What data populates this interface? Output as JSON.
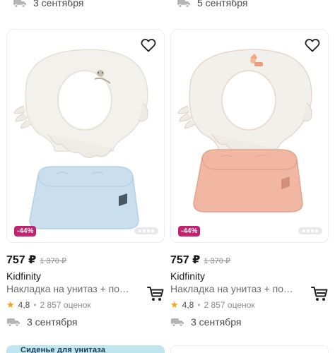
{
  "top": {
    "left_delivery": "3 сентября",
    "right_delivery": "5 сентября"
  },
  "products": [
    {
      "discount": "-44%",
      "price": "757 ₽",
      "old_price": "1 370 ₽",
      "brand": "Kidfinity",
      "title": "Накладка на унитаз + подставка",
      "rating": "4,8",
      "reviews": "2 857 оценок",
      "delivery": "3 сентября",
      "stool_color": "#c9dff0",
      "seat_accent": "sloth-motif"
    },
    {
      "discount": "-44%",
      "price": "757 ₽",
      "old_price": "1 370 ₽",
      "brand": "Kidfinity",
      "title": "Накладка на унитаз + подставка",
      "rating": "4,8",
      "reviews": "2 857 оценок",
      "delivery": "3 сентября",
      "stool_color": "#f1b7a3",
      "seat_accent": "fox-motif"
    }
  ],
  "bottom": {
    "left_banner_text": "Сиденье для унитаза"
  },
  "colors": {
    "badge": "#c22271",
    "star": "#f0a41c"
  }
}
